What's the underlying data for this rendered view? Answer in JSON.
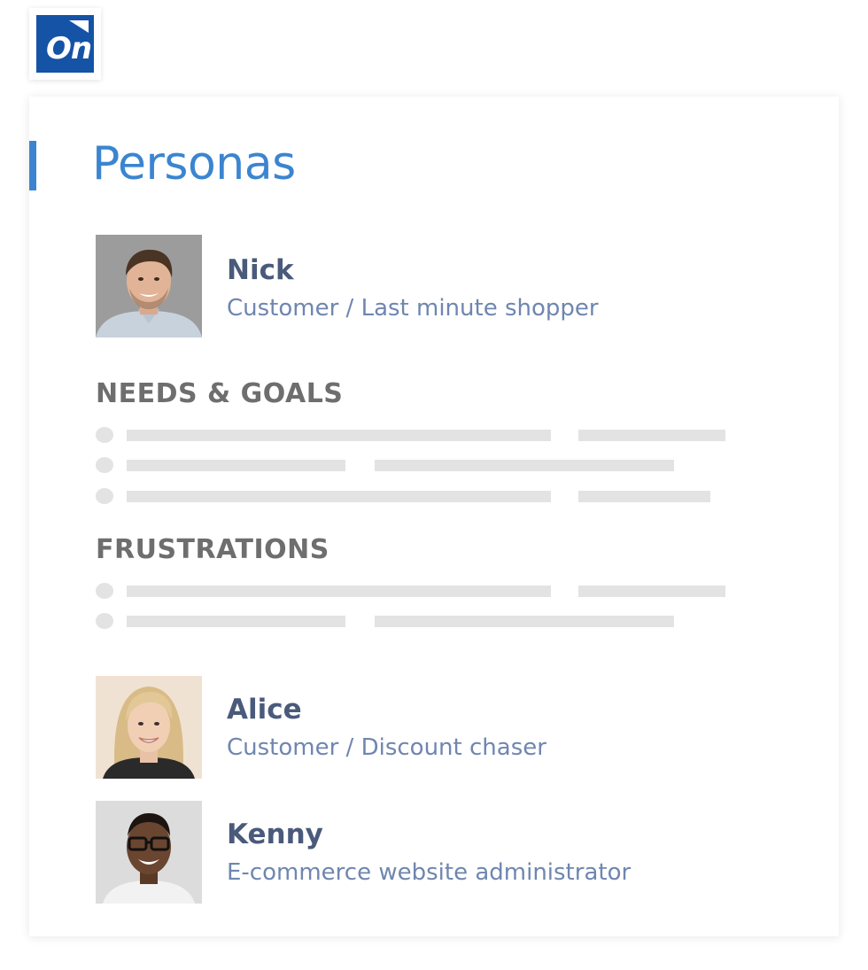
{
  "logo": {
    "text": "On",
    "icon": "onedrive-style-flag-logo"
  },
  "card": {
    "title": "Personas",
    "personas": [
      {
        "name": "Nick",
        "role": "Customer / Last minute shopper",
        "avatar": "man-portrait-grey-background"
      },
      {
        "name": "Alice",
        "role": "Customer / Discount chaser",
        "avatar": "woman-portrait-beige-background"
      },
      {
        "name": "Kenny",
        "role": "E-commerce website administrator",
        "avatar": "man-glasses-portrait-light-background"
      }
    ],
    "sections": [
      {
        "heading": "NEEDS & GOALS",
        "bullet_count": 3
      },
      {
        "heading": "FRUSTRATIONS",
        "bullet_count": 2
      }
    ]
  },
  "colors": {
    "accent": "#3b85d0",
    "logo_bg": "#1553a6",
    "name": "#4a5a7a",
    "role": "#6f86b0",
    "heading": "#6e6e6e",
    "placeholder": "#e3e3e3"
  }
}
